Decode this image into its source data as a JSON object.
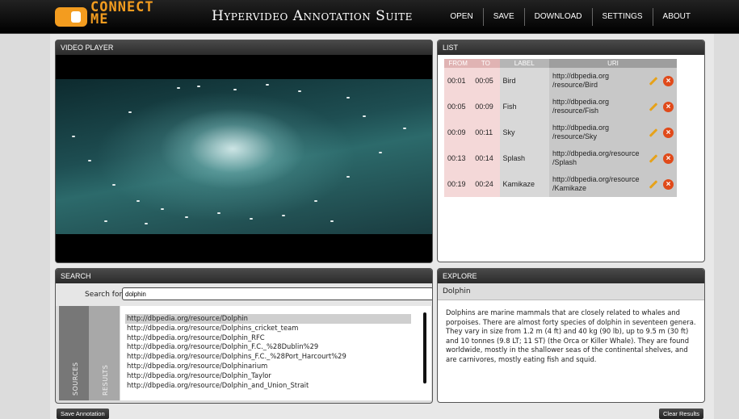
{
  "header": {
    "logo_text": "CONNECT\nME",
    "app_title": "Hypervideo Annotation Suite",
    "nav": [
      "OPEN",
      "SAVE",
      "DOWNLOAD",
      "SETTINGS",
      "ABOUT"
    ]
  },
  "video_player": {
    "title": "VIDEO PLAYER"
  },
  "list": {
    "title": "LIST",
    "columns": {
      "from": "FROM",
      "to": "TO",
      "label": "LABEL",
      "uri": "URI"
    },
    "rows": [
      {
        "from": "00:01",
        "to": "00:05",
        "label": "Bird",
        "uri_line1": "http://dbpedia.org",
        "uri_line2": "/resource/Bird"
      },
      {
        "from": "00:05",
        "to": "00:09",
        "label": "Fish",
        "uri_line1": "http://dbpedia.org",
        "uri_line2": "/resource/Fish"
      },
      {
        "from": "00:09",
        "to": "00:11",
        "label": "Sky",
        "uri_line1": "http://dbpedia.org",
        "uri_line2": "/resource/Sky"
      },
      {
        "from": "00:13",
        "to": "00:14",
        "label": "Splash",
        "uri_line1": "http://dbpedia.org/resource",
        "uri_line2": "/Splash"
      },
      {
        "from": "00:19",
        "to": "00:24",
        "label": "Kamikaze",
        "uri_line1": "http://dbpedia.org/resource",
        "uri_line2": "/Kamikaze"
      }
    ]
  },
  "search": {
    "title": "SEARCH",
    "label": "Search for:",
    "value": "dolphin",
    "sources_label": "SOURCES",
    "results_label": "RESULTS",
    "results": [
      "http://dbpedia.org/resource/Dolphin",
      "http://dbpedia.org/resource/Dolphins_cricket_team",
      "http://dbpedia.org/resource/Dolphin_RFC",
      "http://dbpedia.org/resource/Dolphin_F.C._%28Dublin%29",
      "http://dbpedia.org/resource/Dolphins_F.C._%28Port_Harcourt%29",
      "http://dbpedia.org/resource/Dolphinarium",
      "http://dbpedia.org/resource/Dolphin_Taylor",
      "http://dbpedia.org/resource/Dolphin_and_Union_Strait"
    ]
  },
  "explore": {
    "title": "EXPLORE",
    "subtitle": "Dolphin",
    "text": "Dolphins are marine mammals that are closely related to whales and porpoises. There are almost forty species of dolphin in seventeen genera. They vary in size from 1.2 m (4 ft) and 40 kg (90 lb), up to 9.5 m (30 ft) and 10 tonnes (9.8 LT; 11 ST) (the Orca or Killer Whale). They are found worldwide, mostly in the shallower seas of the continental shelves, and are carnivores, mostly eating fish and squid."
  },
  "buttons": {
    "save_annotation": "Save Annotation",
    "clear_results": "Clear Results"
  },
  "colors": {
    "accent": "#f39c1f",
    "delete": "#e04a1a",
    "edit": "#e6a21a"
  }
}
